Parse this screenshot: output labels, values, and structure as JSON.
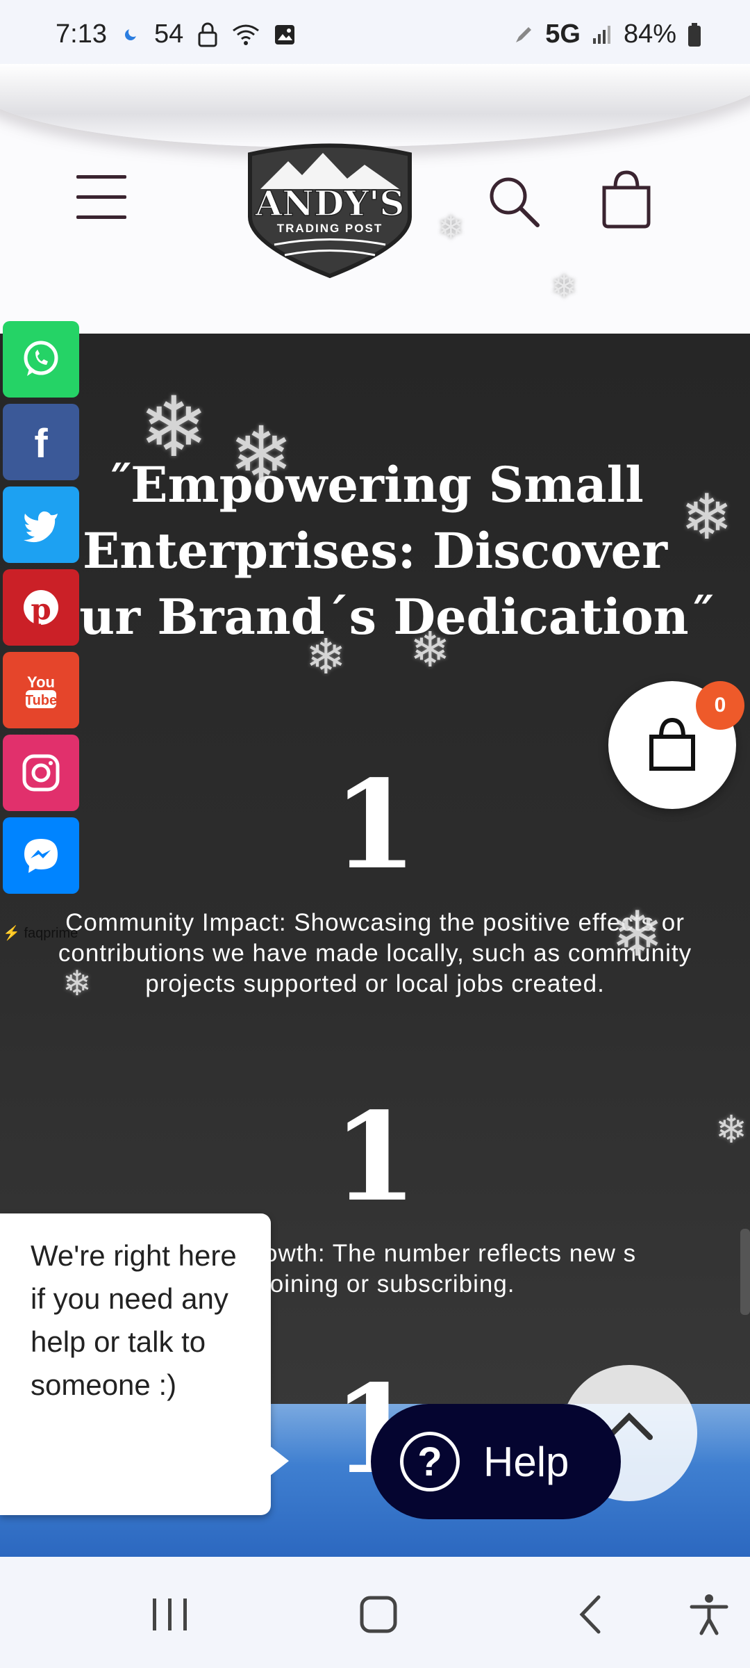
{
  "status_bar": {
    "time": "7:13",
    "temp": "54",
    "network": "5G",
    "battery": "84%"
  },
  "header": {
    "logo_name": "ANDY'S",
    "logo_sub": "TRADING POST"
  },
  "main": {
    "title": "˝Empowering Small Enterprises: Discover Our Brand´s Dedication˝",
    "stats": [
      {
        "number": "1",
        "text": "Community Impact: Showcasing the positive effects or contributions we have made locally, such as community projects supported or local jobs created."
      },
      {
        "number": "1",
        "text": "owth: The number reflects new s joining or subscribing."
      },
      {
        "number": "1"
      }
    ]
  },
  "social": {
    "items": [
      "whatsapp",
      "facebook",
      "twitter",
      "pinterest",
      "youtube",
      "instagram",
      "messenger"
    ],
    "brand": "faqprime"
  },
  "float_cart": {
    "count": "0"
  },
  "help": {
    "bubble_text": "We're right here if you need any help or talk to someone :)",
    "button_label": "Help"
  },
  "colors": {
    "whatsapp": "#25d366",
    "facebook": "#3b5998",
    "twitter": "#1da1f2",
    "pinterest": "#cb2027",
    "youtube": "#e5452b",
    "instagram": "#e1306c",
    "messenger": "#0084ff",
    "badge": "#ee5a2a",
    "help_button": "#050530"
  }
}
